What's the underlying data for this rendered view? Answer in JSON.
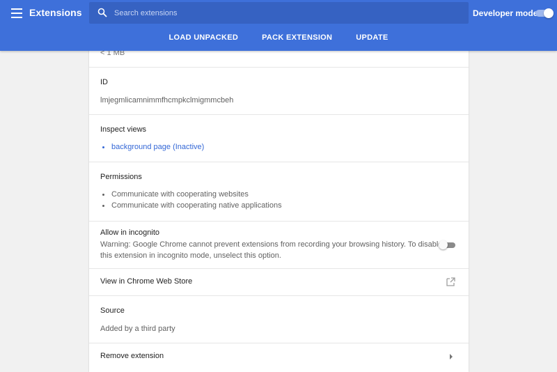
{
  "header": {
    "title": "Extensions",
    "search_placeholder": "Search extensions",
    "developer_mode_label": "Developer mode",
    "developer_mode_on": true,
    "actions": [
      "LOAD UNPACKED",
      "PACK EXTENSION",
      "UPDATE"
    ],
    "accent_color": "#3e70da"
  },
  "details": {
    "size_value": "< 1 MB",
    "id_label": "ID",
    "id_value": "lmjegmlicamnimmfhcmpkclmigmmcbeh",
    "inspect_label": "Inspect views",
    "inspect_link": "background page (Inactive)",
    "permissions_label": "Permissions",
    "permissions": [
      "Communicate with cooperating websites",
      "Communicate with cooperating native applications"
    ],
    "incognito_label": "Allow in incognito",
    "incognito_warning_line1": "Warning: Google Chrome cannot prevent extensions from recording your browsing history. To disable",
    "incognito_warning_line2": "this extension in incognito mode, unselect this option.",
    "incognito_on": false,
    "webstore_label": "View in Chrome Web Store",
    "source_label": "Source",
    "source_value": "Added by a third party",
    "remove_label": "Remove extension"
  }
}
